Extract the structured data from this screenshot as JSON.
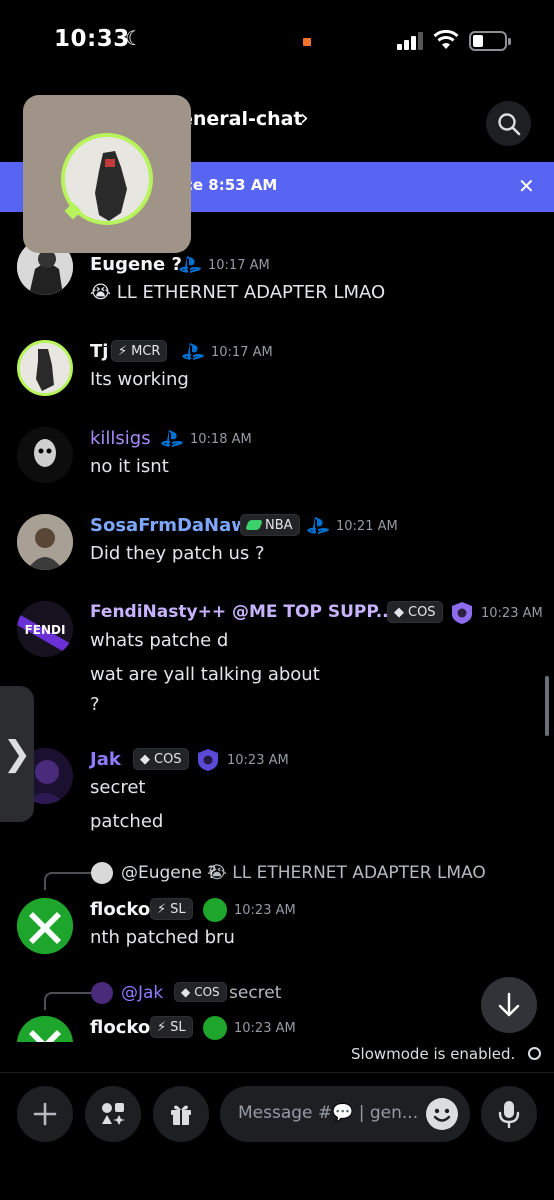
{
  "status_bar": {
    "time": "10:33"
  },
  "header": {
    "channel": "eneral-chat"
  },
  "banner": {
    "text": "ce 8:53 AM",
    "close": "✕"
  },
  "messages": [
    {
      "user": "Eugene ?",
      "time": "10:17 AM",
      "text": "😭 LL ETHERNET ADAPTER LMAO"
    },
    {
      "user": "Tj",
      "tag": "MCR",
      "time": "10:17 AM",
      "text": "Its working"
    },
    {
      "user": "killsigs",
      "time": "10:18 AM",
      "text": "no it isnt"
    },
    {
      "user": "SosaFrmDaNawf",
      "tag": "NBA",
      "time": "10:21 AM",
      "text": "Did they patch us ?"
    },
    {
      "user": "FendiNasty++ @ME TOP SUPP...",
      "tag": "COS",
      "time": "10:23 AM",
      "lines": [
        "whats patche d",
        "wat are yall talking about",
        "?"
      ],
      "avatar_text": "FENDI"
    },
    {
      "user": "Jak",
      "tag": "COS",
      "time": "10:23 AM",
      "lines": [
        "secret",
        "patched"
      ]
    },
    {
      "reply_to": "@Eugene ?",
      "reply_text": "😭  LL ETHERNET ADAPTER LMAO",
      "user": "flocko",
      "tag": "SL",
      "time": "10:23 AM",
      "text": "nth patched bru"
    },
    {
      "reply_to": "@Jak",
      "reply_tag": "COS",
      "reply_text": "secret",
      "user": "flocko",
      "tag": "SL",
      "time": "10:23 AM"
    }
  ],
  "slowmode": "Slowmode is enabled.",
  "composer": {
    "placeholder": "Message #💬 | gen..."
  },
  "colors": {
    "accent": "#5865f2",
    "background": "#000000",
    "playstation": "#0070d1",
    "xbox": "#1ea52c"
  }
}
